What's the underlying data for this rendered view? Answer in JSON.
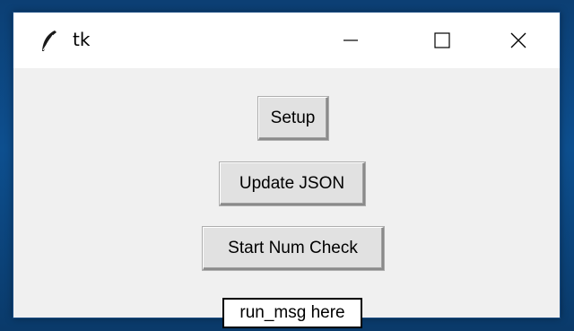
{
  "window": {
    "title": "tk"
  },
  "buttons": {
    "setup": "Setup",
    "update_json": "Update JSON",
    "start_num_check": "Start Num Check"
  },
  "status": {
    "run_msg": "run_msg here"
  },
  "icons": {
    "app": "tk-feather-icon",
    "minimize": "minimize-icon",
    "maximize": "maximize-icon",
    "close": "close-icon"
  },
  "colors": {
    "desktop": "#0d4f8f",
    "titlebar": "#ffffff",
    "client": "#f0f0f0",
    "button_face": "#e1e1e1"
  }
}
